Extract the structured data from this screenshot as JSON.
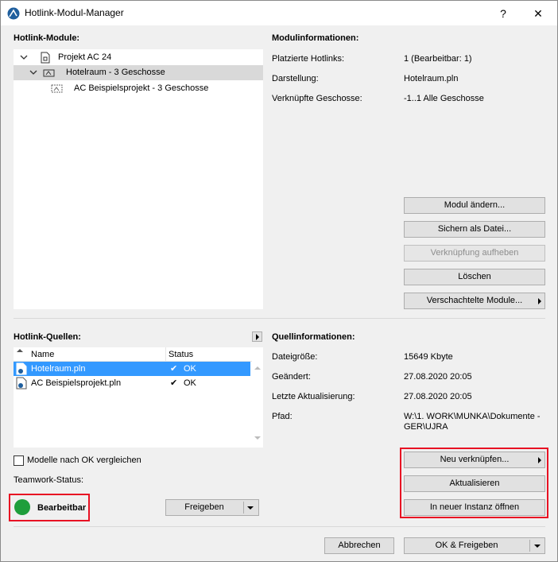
{
  "window": {
    "title": "Hotlink-Modul-Manager",
    "help_label": "?",
    "close_label": "✕"
  },
  "modules": {
    "section_label": "Hotlink-Module:",
    "tree": [
      {
        "label": "Projekt AC 24",
        "icon": "project-file-icon"
      },
      {
        "label": "Hotelraum - 3 Geschosse",
        "icon": "hotlink-module-icon"
      },
      {
        "label": "AC Beispielsprojekt - 3 Geschosse",
        "icon": "hotlink-module-icon"
      }
    ]
  },
  "module_info": {
    "section_label": "Modulinformationen:",
    "rows": [
      {
        "key": "Platzierte Hotlinks:",
        "value": "1 (Bearbeitbar: 1)"
      },
      {
        "key": "Darstellung:",
        "value": "Hotelraum.pln"
      },
      {
        "key": "Verknüpfte Geschosse:",
        "value": "-1..1 Alle Geschosse"
      }
    ],
    "buttons": {
      "edit": "Modul ändern...",
      "save": "Sichern als Datei...",
      "unlink": "Verknüpfung aufheben",
      "delete": "Löschen",
      "nested": "Verschachtelte Module..."
    }
  },
  "sources": {
    "section_label": "Hotlink-Quellen:",
    "col_name": "Name",
    "col_status": "Status",
    "rows": [
      {
        "name": "Hotelraum.pln",
        "status": "OK",
        "check": "✔"
      },
      {
        "name": "AC Beispielsprojekt.pln",
        "status": "OK",
        "check": "✔"
      }
    ],
    "compare_label": "Modelle nach OK vergleichen",
    "compare_checked": false
  },
  "source_info": {
    "section_label": "Quellinformationen:",
    "rows": [
      {
        "key": "Dateigröße:",
        "value": "15649 Kbyte"
      },
      {
        "key": "Geändert:",
        "value": "27.08.2020 20:05"
      },
      {
        "key": "Letzte Aktualisierung:",
        "value": "27.08.2020 20:05"
      }
    ],
    "path_key": "Pfad:",
    "path_line1": "W:\\1. WORK\\MUNKA\\Dokumente -",
    "path_line2": "GER\\UJRA",
    "buttons": {
      "relink": "Neu verknüpfen...",
      "update": "Aktualisieren",
      "open_instance": "In neuer Instanz öffnen"
    }
  },
  "teamwork": {
    "label": "Teamwork-Status:",
    "status": "Bearbeitbar",
    "status_color": "#1e9e3b",
    "release_label": "Freigeben"
  },
  "footer": {
    "cancel": "Abbrechen",
    "ok_release": "OK & Freigeben"
  }
}
